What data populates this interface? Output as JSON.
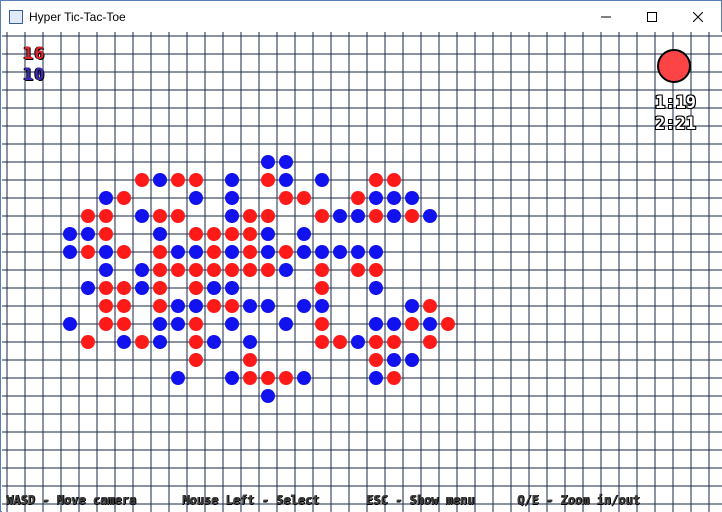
{
  "window": {
    "title": "Hyper Tic-Tac-Toe"
  },
  "controls": {
    "minimize": "—",
    "maximize": "☐",
    "close": "✕"
  },
  "scores": {
    "red": "16",
    "blue": "10"
  },
  "turn": {
    "player": "red",
    "color": "#fc4447"
  },
  "timers": {
    "first": "1:19",
    "second": "2:21"
  },
  "help": [
    "WASD - Move camera",
    "Mouse Left - Select",
    "ESC - Show menu",
    "Q/E - Zoom in/out"
  ],
  "colors": {
    "red": "#ff1a1a",
    "blue": "#1212ee",
    "grid": "#1a2a4a"
  },
  "board": {
    "columns": [
      "c0",
      "c1",
      "c2",
      "c3",
      "c4",
      "c5",
      "c6",
      "c7",
      "c8",
      "c9",
      "c10",
      "c11",
      "c12",
      "c13",
      "c14",
      "c15",
      "c16",
      "c17",
      "c18",
      "c19",
      "c20",
      "c21",
      "c22",
      "c23",
      "c24",
      "c25",
      "c26",
      "c27",
      "c28",
      "c29",
      "c30",
      "c31",
      "c32",
      "c33",
      "c34",
      "c35",
      "c36",
      "c37",
      "c38",
      "c39"
    ],
    "pieces": [
      {
        "c": 15,
        "r": 7,
        "p": "B"
      },
      {
        "c": 16,
        "r": 7,
        "p": "B"
      },
      {
        "c": 8,
        "r": 8,
        "p": "R"
      },
      {
        "c": 9,
        "r": 8,
        "p": "B"
      },
      {
        "c": 10,
        "r": 8,
        "p": "R"
      },
      {
        "c": 11,
        "r": 8,
        "p": "R"
      },
      {
        "c": 13,
        "r": 8,
        "p": "B"
      },
      {
        "c": 15,
        "r": 8,
        "p": "R"
      },
      {
        "c": 16,
        "r": 8,
        "p": "B"
      },
      {
        "c": 18,
        "r": 8,
        "p": "B"
      },
      {
        "c": 21,
        "r": 8,
        "p": "R"
      },
      {
        "c": 22,
        "r": 8,
        "p": "R"
      },
      {
        "c": 6,
        "r": 9,
        "p": "B"
      },
      {
        "c": 7,
        "r": 9,
        "p": "R"
      },
      {
        "c": 11,
        "r": 9,
        "p": "B"
      },
      {
        "c": 13,
        "r": 9,
        "p": "B"
      },
      {
        "c": 16,
        "r": 9,
        "p": "R"
      },
      {
        "c": 17,
        "r": 9,
        "p": "R"
      },
      {
        "c": 20,
        "r": 9,
        "p": "R"
      },
      {
        "c": 21,
        "r": 9,
        "p": "B"
      },
      {
        "c": 22,
        "r": 9,
        "p": "B"
      },
      {
        "c": 23,
        "r": 9,
        "p": "B"
      },
      {
        "c": 5,
        "r": 10,
        "p": "R"
      },
      {
        "c": 6,
        "r": 10,
        "p": "R"
      },
      {
        "c": 8,
        "r": 10,
        "p": "B"
      },
      {
        "c": 9,
        "r": 10,
        "p": "R"
      },
      {
        "c": 10,
        "r": 10,
        "p": "R"
      },
      {
        "c": 13,
        "r": 10,
        "p": "B"
      },
      {
        "c": 14,
        "r": 10,
        "p": "R"
      },
      {
        "c": 15,
        "r": 10,
        "p": "R"
      },
      {
        "c": 18,
        "r": 10,
        "p": "R"
      },
      {
        "c": 19,
        "r": 10,
        "p": "B"
      },
      {
        "c": 20,
        "r": 10,
        "p": "B"
      },
      {
        "c": 21,
        "r": 10,
        "p": "R"
      },
      {
        "c": 22,
        "r": 10,
        "p": "B"
      },
      {
        "c": 23,
        "r": 10,
        "p": "R"
      },
      {
        "c": 24,
        "r": 10,
        "p": "B"
      },
      {
        "c": 4,
        "r": 11,
        "p": "B"
      },
      {
        "c": 5,
        "r": 11,
        "p": "B"
      },
      {
        "c": 6,
        "r": 11,
        "p": "R"
      },
      {
        "c": 9,
        "r": 11,
        "p": "B"
      },
      {
        "c": 11,
        "r": 11,
        "p": "R"
      },
      {
        "c": 12,
        "r": 11,
        "p": "R"
      },
      {
        "c": 13,
        "r": 11,
        "p": "R"
      },
      {
        "c": 14,
        "r": 11,
        "p": "R"
      },
      {
        "c": 15,
        "r": 11,
        "p": "B"
      },
      {
        "c": 17,
        "r": 11,
        "p": "B"
      },
      {
        "c": 4,
        "r": 12,
        "p": "B"
      },
      {
        "c": 5,
        "r": 12,
        "p": "R"
      },
      {
        "c": 6,
        "r": 12,
        "p": "B"
      },
      {
        "c": 7,
        "r": 12,
        "p": "R"
      },
      {
        "c": 9,
        "r": 12,
        "p": "R"
      },
      {
        "c": 10,
        "r": 12,
        "p": "B"
      },
      {
        "c": 11,
        "r": 12,
        "p": "B"
      },
      {
        "c": 12,
        "r": 12,
        "p": "R"
      },
      {
        "c": 13,
        "r": 12,
        "p": "B"
      },
      {
        "c": 14,
        "r": 12,
        "p": "R"
      },
      {
        "c": 15,
        "r": 12,
        "p": "B"
      },
      {
        "c": 16,
        "r": 12,
        "p": "R"
      },
      {
        "c": 17,
        "r": 12,
        "p": "B"
      },
      {
        "c": 18,
        "r": 12,
        "p": "B"
      },
      {
        "c": 19,
        "r": 12,
        "p": "B"
      },
      {
        "c": 20,
        "r": 12,
        "p": "B"
      },
      {
        "c": 21,
        "r": 12,
        "p": "B"
      },
      {
        "c": 6,
        "r": 13,
        "p": "B"
      },
      {
        "c": 8,
        "r": 13,
        "p": "B"
      },
      {
        "c": 9,
        "r": 13,
        "p": "R"
      },
      {
        "c": 10,
        "r": 13,
        "p": "R"
      },
      {
        "c": 11,
        "r": 13,
        "p": "R"
      },
      {
        "c": 12,
        "r": 13,
        "p": "R"
      },
      {
        "c": 13,
        "r": 13,
        "p": "R"
      },
      {
        "c": 14,
        "r": 13,
        "p": "R"
      },
      {
        "c": 15,
        "r": 13,
        "p": "R"
      },
      {
        "c": 16,
        "r": 13,
        "p": "B"
      },
      {
        "c": 18,
        "r": 13,
        "p": "R"
      },
      {
        "c": 20,
        "r": 13,
        "p": "R"
      },
      {
        "c": 21,
        "r": 13,
        "p": "R"
      },
      {
        "c": 5,
        "r": 14,
        "p": "B"
      },
      {
        "c": 6,
        "r": 14,
        "p": "R"
      },
      {
        "c": 7,
        "r": 14,
        "p": "R"
      },
      {
        "c": 8,
        "r": 14,
        "p": "B"
      },
      {
        "c": 9,
        "r": 14,
        "p": "R"
      },
      {
        "c": 11,
        "r": 14,
        "p": "R"
      },
      {
        "c": 12,
        "r": 14,
        "p": "B"
      },
      {
        "c": 13,
        "r": 14,
        "p": "B"
      },
      {
        "c": 18,
        "r": 14,
        "p": "R"
      },
      {
        "c": 21,
        "r": 14,
        "p": "B"
      },
      {
        "c": 6,
        "r": 15,
        "p": "R"
      },
      {
        "c": 7,
        "r": 15,
        "p": "R"
      },
      {
        "c": 9,
        "r": 15,
        "p": "R"
      },
      {
        "c": 10,
        "r": 15,
        "p": "B"
      },
      {
        "c": 11,
        "r": 15,
        "p": "B"
      },
      {
        "c": 12,
        "r": 15,
        "p": "R"
      },
      {
        "c": 13,
        "r": 15,
        "p": "R"
      },
      {
        "c": 14,
        "r": 15,
        "p": "B"
      },
      {
        "c": 15,
        "r": 15,
        "p": "B"
      },
      {
        "c": 17,
        "r": 15,
        "p": "B"
      },
      {
        "c": 18,
        "r": 15,
        "p": "B"
      },
      {
        "c": 23,
        "r": 15,
        "p": "B"
      },
      {
        "c": 24,
        "r": 15,
        "p": "R"
      },
      {
        "c": 4,
        "r": 16,
        "p": "B"
      },
      {
        "c": 6,
        "r": 16,
        "p": "R"
      },
      {
        "c": 7,
        "r": 16,
        "p": "R"
      },
      {
        "c": 9,
        "r": 16,
        "p": "B"
      },
      {
        "c": 10,
        "r": 16,
        "p": "B"
      },
      {
        "c": 11,
        "r": 16,
        "p": "R"
      },
      {
        "c": 13,
        "r": 16,
        "p": "B"
      },
      {
        "c": 16,
        "r": 16,
        "p": "B"
      },
      {
        "c": 18,
        "r": 16,
        "p": "R"
      },
      {
        "c": 21,
        "r": 16,
        "p": "B"
      },
      {
        "c": 22,
        "r": 16,
        "p": "B"
      },
      {
        "c": 23,
        "r": 16,
        "p": "R"
      },
      {
        "c": 24,
        "r": 16,
        "p": "B"
      },
      {
        "c": 25,
        "r": 16,
        "p": "R"
      },
      {
        "c": 5,
        "r": 17,
        "p": "R"
      },
      {
        "c": 7,
        "r": 17,
        "p": "B"
      },
      {
        "c": 8,
        "r": 17,
        "p": "R"
      },
      {
        "c": 9,
        "r": 17,
        "p": "B"
      },
      {
        "c": 11,
        "r": 17,
        "p": "R"
      },
      {
        "c": 12,
        "r": 17,
        "p": "B"
      },
      {
        "c": 14,
        "r": 17,
        "p": "B"
      },
      {
        "c": 18,
        "r": 17,
        "p": "R"
      },
      {
        "c": 19,
        "r": 17,
        "p": "R"
      },
      {
        "c": 20,
        "r": 17,
        "p": "B"
      },
      {
        "c": 21,
        "r": 17,
        "p": "R"
      },
      {
        "c": 22,
        "r": 17,
        "p": "R"
      },
      {
        "c": 24,
        "r": 17,
        "p": "R"
      },
      {
        "c": 11,
        "r": 18,
        "p": "R"
      },
      {
        "c": 14,
        "r": 18,
        "p": "R"
      },
      {
        "c": 21,
        "r": 18,
        "p": "R"
      },
      {
        "c": 22,
        "r": 18,
        "p": "B"
      },
      {
        "c": 23,
        "r": 18,
        "p": "B"
      },
      {
        "c": 10,
        "r": 19,
        "p": "B"
      },
      {
        "c": 13,
        "r": 19,
        "p": "B"
      },
      {
        "c": 14,
        "r": 19,
        "p": "R"
      },
      {
        "c": 15,
        "r": 19,
        "p": "R"
      },
      {
        "c": 16,
        "r": 19,
        "p": "R"
      },
      {
        "c": 17,
        "r": 19,
        "p": "B"
      },
      {
        "c": 21,
        "r": 19,
        "p": "B"
      },
      {
        "c": 22,
        "r": 19,
        "p": "R"
      },
      {
        "c": 15,
        "r": 20,
        "p": "B"
      }
    ]
  }
}
